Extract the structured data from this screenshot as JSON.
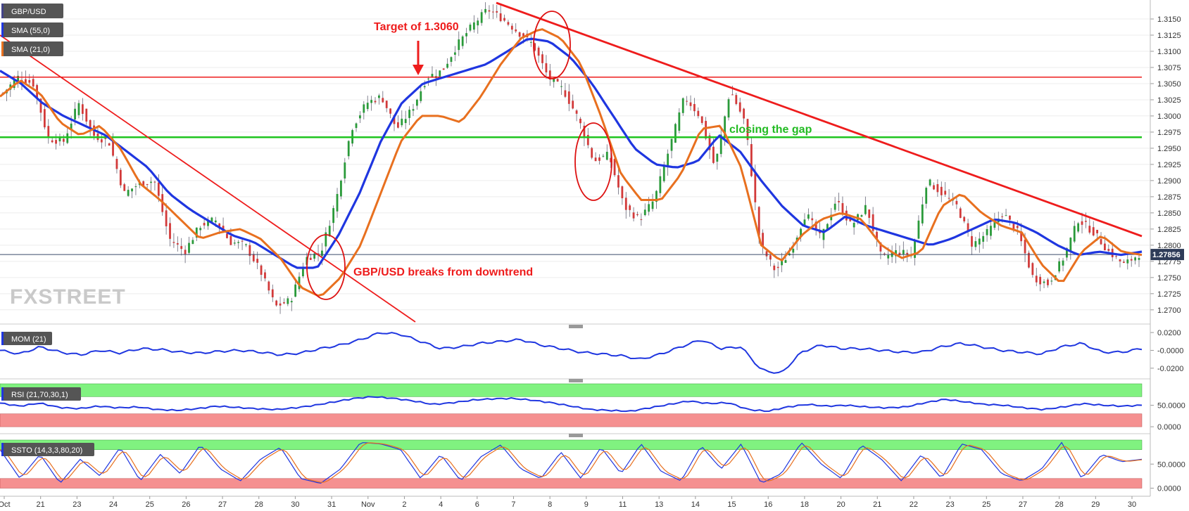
{
  "chart_data": [
    {
      "panel": "price",
      "type": "candlestick",
      "symbol": "GBP/USD",
      "indicators": [
        "SMA (55,0)",
        "SMA (21,0)"
      ],
      "price_axis": {
        "ylim": [
          1.269,
          1.3175
        ],
        "ticks": [
          "1.3150",
          "1.3125",
          "1.3100",
          "1.3075",
          "1.3050",
          "1.3025",
          "1.3000",
          "1.2975",
          "1.2950",
          "1.2925",
          "1.2900",
          "1.2875",
          "1.2850",
          "1.2825",
          "1.2800",
          "1.2775",
          "1.2750",
          "1.2725",
          "1.2700"
        ]
      },
      "last_price": "1.27856",
      "x_ticks": [
        "Oct",
        "21",
        "23",
        "24",
        "25",
        "26",
        "27",
        "28",
        "30",
        "31",
        "Nov",
        "2",
        "4",
        "6",
        "7",
        "8",
        "9",
        "11",
        "13",
        "14",
        "15",
        "16",
        "18",
        "20",
        "21",
        "22",
        "23",
        "25",
        "27",
        "28",
        "29",
        "30"
      ],
      "close_path": [
        1.3035,
        1.306,
        1.305,
        1.2965,
        1.296,
        1.302,
        1.297,
        1.296,
        1.288,
        1.2895,
        1.29,
        1.281,
        1.279,
        1.283,
        1.284,
        1.2805,
        1.28,
        1.276,
        1.2705,
        1.2715,
        1.278,
        1.279,
        1.287,
        1.298,
        1.302,
        1.303,
        1.298,
        1.301,
        1.306,
        1.307,
        1.311,
        1.314,
        1.3165,
        1.315,
        1.313,
        1.311,
        1.306,
        1.304,
        1.2995,
        1.293,
        1.294,
        1.286,
        1.284,
        1.287,
        1.295,
        1.303,
        1.3,
        1.292,
        1.304,
        1.299,
        1.28,
        1.276,
        1.279,
        1.285,
        1.281,
        1.287,
        1.283,
        1.286,
        1.278,
        1.279,
        1.2785,
        1.29,
        1.288,
        1.286,
        1.28,
        1.282,
        1.285,
        1.282,
        1.275,
        1.274,
        1.278,
        1.284,
        1.282,
        1.279,
        1.277,
        1.2786
      ],
      "sma55_path": [
        1.307,
        1.305,
        1.302,
        1.3,
        1.2985,
        1.297,
        1.2945,
        1.292,
        1.288,
        1.2855,
        1.2835,
        1.2815,
        1.2805,
        1.2785,
        1.2765,
        1.2765,
        1.2815,
        1.288,
        1.296,
        1.302,
        1.305,
        1.306,
        1.307,
        1.308,
        1.31,
        1.312,
        1.3115,
        1.309,
        1.305,
        1.3,
        1.295,
        1.2925,
        1.292,
        1.293,
        1.297,
        1.2945,
        1.29,
        1.286,
        1.283,
        1.282,
        1.2845,
        1.283,
        1.282,
        1.281,
        1.28,
        1.281,
        1.2825,
        1.284,
        1.2835,
        1.282,
        1.28,
        1.2785,
        1.279,
        1.2785,
        1.279
      ],
      "sma21_path": [
        1.303,
        1.3055,
        1.3035,
        1.299,
        1.297,
        1.2985,
        1.295,
        1.2895,
        1.287,
        1.284,
        1.281,
        1.282,
        1.2825,
        1.281,
        1.278,
        1.2735,
        1.272,
        1.275,
        1.28,
        1.288,
        1.296,
        1.3,
        1.3,
        1.299,
        1.303,
        1.308,
        1.312,
        1.3135,
        1.312,
        1.308,
        1.3,
        1.291,
        1.287,
        1.287,
        1.291,
        1.298,
        1.2985,
        1.292,
        1.28,
        1.2775,
        1.2815,
        1.284,
        1.285,
        1.284,
        1.28,
        1.278,
        1.279,
        1.286,
        1.288,
        1.285,
        1.283,
        1.282,
        1.277,
        1.274,
        1.279,
        1.2815,
        1.279,
        1.2785
      ],
      "annotations": {
        "target": "Target of 1.3060",
        "gap": "closing the gap",
        "breakout": "GBP/USD breaks from downtrend"
      },
      "levels": {
        "target_line": 1.306,
        "gap_line": 1.2967,
        "last_line": 1.27856
      },
      "watermark": "FXSTREET"
    },
    {
      "panel": "momentum",
      "type": "line",
      "label": "MOM (21)",
      "ylim": [
        -0.028,
        0.024
      ],
      "ticks": [
        "0.0200",
        "-0.0000",
        "-0.0200"
      ],
      "path": [
        0.0,
        -0.004,
        0.004,
        -0.002,
        -0.005,
        0.0,
        -0.003,
        0.002,
        0.001,
        -0.002,
        -0.003,
        -0.001,
        0.0,
        -0.002,
        -0.005,
        -0.003,
        0.002,
        0.006,
        0.012,
        0.02,
        0.018,
        0.01,
        0.002,
        0.004,
        0.008,
        0.01,
        0.012,
        0.006,
        0.002,
        -0.002,
        -0.004,
        -0.006,
        -0.01,
        -0.004,
        0.004,
        0.012,
        0.002,
        0.004,
        -0.022,
        -0.026,
        -0.002,
        0.006,
        0.002,
        0.002,
        0.0,
        -0.002,
        -0.002,
        0.004,
        0.008,
        0.004,
        0.0,
        -0.002,
        -0.004,
        0.004,
        0.008,
        -0.002,
        -0.002,
        0.002
      ]
    },
    {
      "panel": "rsi",
      "type": "line",
      "label": "RSI (21,70,30,1)",
      "ylim": [
        -8,
        100
      ],
      "ticks": [
        "50.0000",
        "0.0000"
      ],
      "bands": {
        "upper": 70,
        "lower": 30
      },
      "path": [
        55,
        48,
        55,
        45,
        42,
        48,
        44,
        46,
        40,
        38,
        42,
        48,
        45,
        42,
        40,
        44,
        50,
        58,
        66,
        70,
        66,
        60,
        52,
        56,
        62,
        65,
        66,
        62,
        56,
        48,
        40,
        38,
        36,
        44,
        52,
        60,
        54,
        56,
        40,
        36,
        46,
        52,
        48,
        50,
        46,
        44,
        46,
        56,
        64,
        58,
        52,
        50,
        44,
        40,
        46,
        54,
        50,
        48,
        50
      ]
    },
    {
      "panel": "stochastic",
      "type": "line",
      "label": "SSTO (14,3,3,80,20)",
      "ylim": [
        -8,
        100
      ],
      "ticks": [
        "50.0000",
        "0.0000"
      ],
      "bands": {
        "upper": 80,
        "lower": 20
      },
      "path": [
        80,
        20,
        70,
        10,
        60,
        25,
        85,
        15,
        70,
        30,
        90,
        40,
        15,
        60,
        85,
        20,
        10,
        40,
        95,
        92,
        80,
        20,
        70,
        15,
        65,
        90,
        40,
        20,
        75,
        20,
        85,
        30,
        92,
        35,
        15,
        88,
        40,
        92,
        10,
        30,
        95,
        50,
        20,
        90,
        60,
        15,
        70,
        20,
        92,
        80,
        30,
        15,
        40,
        95,
        20,
        70,
        55,
        60
      ]
    }
  ]
}
